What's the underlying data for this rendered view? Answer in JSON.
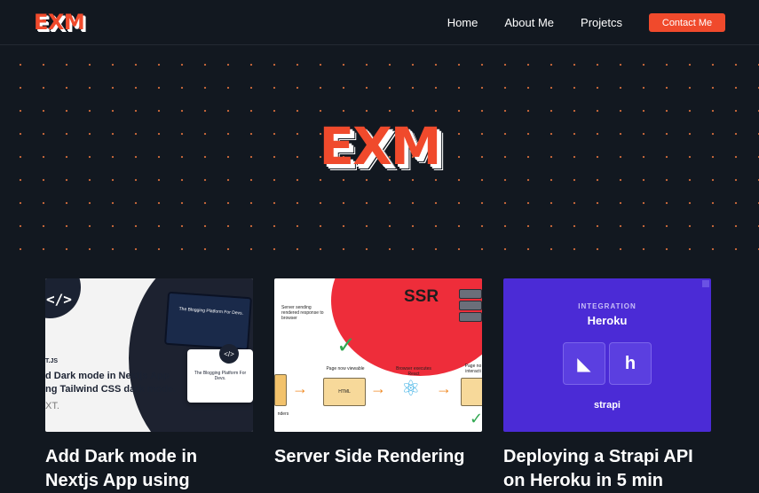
{
  "nav": {
    "logo": "EXM",
    "links": [
      "Home",
      "About Me",
      "Projetcs"
    ],
    "contact_label": "Contact Me"
  },
  "hero": {
    "logo": "EXM"
  },
  "cards": [
    {
      "title": "Add Dark mode in Nextjs App using",
      "thumb": {
        "lines": [
          "d Dark mode in Nextjs App",
          "ng Tailwind CSS dark mode."
        ],
        "small": "T.JS",
        "muted": "XT.",
        "screen1": "The Blogging Platform For Devs.",
        "screen2": "The Blogging Platform For Devs."
      }
    },
    {
      "title": "Server Side Rendering",
      "thumb": {
        "ssr": "SSR",
        "label_server": "Server sending rendered response to browser",
        "label_page": "Page now viewable",
        "label_browser": "Browser executes React",
        "label_page2": "Page no interacti",
        "label_renders": "nders",
        "html": "HTML"
      }
    },
    {
      "title": "Deploying a Strapi API on Heroku in 5 min",
      "thumb": {
        "integration": "INTEGRATION",
        "heroku": "Heroku",
        "strapi": "strapi"
      }
    }
  ],
  "colors": {
    "background": "#121820",
    "accent": "#f04a2c",
    "dot": "#c8673a"
  }
}
